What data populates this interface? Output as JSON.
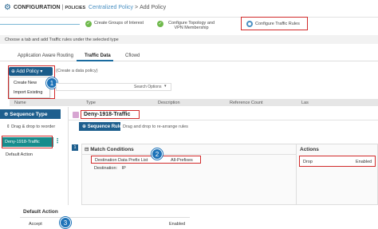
{
  "header": {
    "title": "CONFIGURATION",
    "title_sep": "|",
    "section": "POLICIES",
    "crumb_link": "Centralized Policy",
    "crumb_sep": ">",
    "crumb_current": "Add Policy"
  },
  "steps": [
    {
      "label_line1": "Create Groups of Interest",
      "label_line2": ""
    },
    {
      "label_line1": "Configure Topology and",
      "label_line2": "VPN Membership"
    },
    {
      "label_line1": "Configure Traffic Rules",
      "label_line2": ""
    }
  ],
  "instruction": "Choose a tab and add Traffic rules under the selected type",
  "tabs": [
    "Application Aware Routing",
    "Traffic Data",
    "Cflowd"
  ],
  "add_policy": {
    "label": "Add Policy",
    "hint": "(Create a data policy)"
  },
  "menu": [
    "Create New",
    "Import Existing"
  ],
  "search_options": "Search Options",
  "table_headers": [
    "Name",
    "Type",
    "Description",
    "Reference Count",
    "Las"
  ],
  "sequence_type": "Sequence Type",
  "drag_drop_reorder": "Drag & drop to reorder",
  "policy_name": "Deny-1918-Traffic",
  "sequence_rule": "Sequence Rule",
  "drag_drop_rearrange": "Drag and drop to re-arrange rules",
  "sidebar_item": "Deny-1918-Traffic",
  "default_action_label": "Default Action",
  "rule_number": "1",
  "match_conditions": {
    "title": "Match Conditions",
    "row1_label": "Destination Data Prefix List",
    "row1_value": "All-Prefixes",
    "row2_label": "Destination:",
    "row2_value": "IP"
  },
  "actions": {
    "title": "Actions",
    "action": "Drop",
    "status": "Enabled"
  },
  "default_action_card": {
    "title": "Default Action",
    "action": "Accept",
    "status": "Enabled"
  },
  "badges": [
    "1",
    "2",
    "3"
  ],
  "colors": {
    "primary": "#1e5f8e",
    "accent": "#4a90c2",
    "highlight": "#d12a2a",
    "teal": "#178c8c",
    "success": "#6fb94c"
  }
}
